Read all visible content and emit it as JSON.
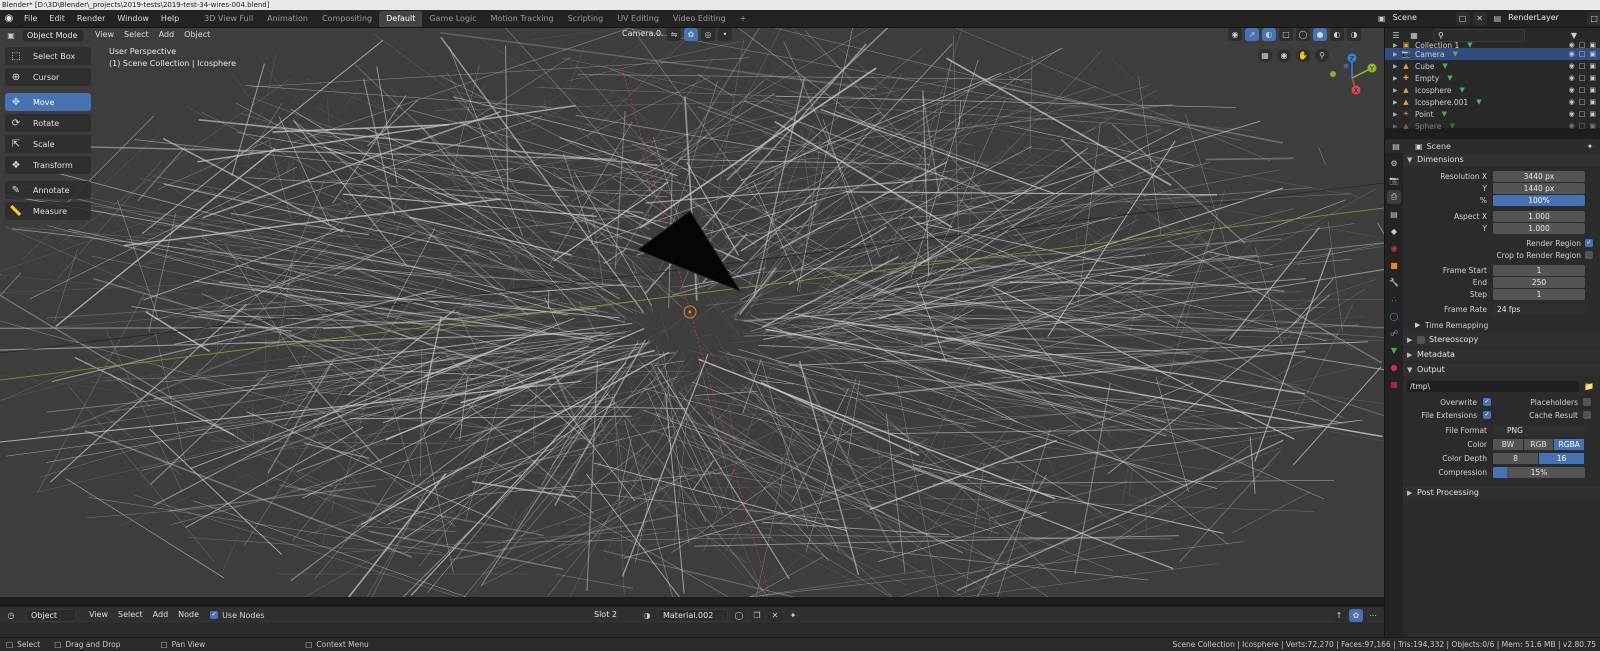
{
  "window": {
    "title": "Blender* [D:\\3D\\Blender\\_projects\\2019-tests\\2019-test-34-wires-004.blend]"
  },
  "menubar": {
    "items": [
      "File",
      "Edit",
      "Render",
      "Window",
      "Help"
    ],
    "workspaces": [
      "3D View Full",
      "Animation",
      "Compositing",
      "Default",
      "Game Logic",
      "Motion Tracking",
      "Scripting",
      "UV Editing",
      "Video Editing"
    ],
    "active_workspace": "Default",
    "add_tab": "+",
    "scene": "Scene",
    "view_layer": "RenderLayer"
  },
  "viewport": {
    "mode": "Object Mode",
    "menus": [
      "View",
      "Select",
      "Add",
      "Object"
    ],
    "camera_field": "Camera.0...",
    "perspective": "User Perspective",
    "collection_info": "(1) Scene Collection | Icosphere",
    "tools": [
      {
        "label": "Select Box",
        "icon": "select-box-icon"
      },
      {
        "label": "Cursor",
        "icon": "cursor-icon"
      },
      {
        "label": "Move",
        "icon": "move-icon",
        "active": true
      },
      {
        "label": "Rotate",
        "icon": "rotate-icon"
      },
      {
        "label": "Scale",
        "icon": "scale-icon"
      },
      {
        "label": "Transform",
        "icon": "transform-icon"
      },
      {
        "label": "Annotate",
        "icon": "annotate-icon"
      },
      {
        "label": "Measure",
        "icon": "measure-icon"
      }
    ],
    "gizmo": {
      "x": "X",
      "y": "Y",
      "z": "Z"
    },
    "colors": {
      "background": "#3d3d3d",
      "wire": "#c8c8c8",
      "x_axis": "#c23b3b",
      "y_axis": "#8a9a2a",
      "active": "#4772b3"
    }
  },
  "shader_header": {
    "editor": "Object",
    "menus": [
      "View",
      "Select",
      "Add",
      "Node"
    ],
    "use_nodes_label": "Use Nodes",
    "slot": "Slot 2",
    "material": "Material.002"
  },
  "statusbar": {
    "select": "Select",
    "drag": "Drag and Drop",
    "pan": "Pan View",
    "context": "Context Menu",
    "stats": "Scene Collection | Icosphere | Verts:72,270 | Faces:97,166 | Tris:194,332 | Objects:0/6 | Mem: 51.6 MB | v2.80.75"
  },
  "outliner": {
    "search_placeholder": "",
    "rows": [
      {
        "name": "Collection 1",
        "icon": "collection-icon",
        "partial": true
      },
      {
        "name": "Camera",
        "icon": "camera-icon",
        "selected": true
      },
      {
        "name": "Cube",
        "icon": "mesh-icon"
      },
      {
        "name": "Empty",
        "icon": "empty-icon"
      },
      {
        "name": "Icosphere",
        "icon": "mesh-icon"
      },
      {
        "name": "Icosphere.001",
        "icon": "mesh-icon"
      },
      {
        "name": "Point",
        "icon": "light-icon"
      },
      {
        "name": "Sphere",
        "icon": "mesh-icon",
        "dim": true
      }
    ]
  },
  "properties": {
    "context": "Scene",
    "dimensions": {
      "title": "Dimensions",
      "res_x_label": "Resolution X",
      "res_x": "3440 px",
      "res_y_label": "Y",
      "res_y": "1440 px",
      "pct_label": "%",
      "pct": "100%",
      "aspect_x_label": "Aspect X",
      "aspect_x": "1.000",
      "aspect_y_label": "Y",
      "aspect_y": "1.000",
      "render_region": "Render Region",
      "crop_region": "Crop to Render Region",
      "frame_start_label": "Frame Start",
      "frame_start": "1",
      "end_label": "End",
      "end": "250",
      "step_label": "Step",
      "step": "1",
      "frame_rate_label": "Frame Rate",
      "frame_rate": "24 fps",
      "time_remapping": "Time Remapping"
    },
    "stereoscopy": "Stereoscopy",
    "metadata": "Metadata",
    "output": {
      "title": "Output",
      "path": "/tmp\\",
      "overwrite": "Overwrite",
      "placeholders": "Placeholders",
      "file_extensions": "File Extensions",
      "cache_result": "Cache Result",
      "file_format_label": "File Format",
      "file_format": "PNG",
      "color_label": "Color",
      "color_options": [
        "BW",
        "RGB",
        "RGBA"
      ],
      "color_selected": "RGBA",
      "depth_label": "Color Depth",
      "depth_options": [
        "8",
        "16"
      ],
      "depth_selected": "16",
      "compression_label": "Compression",
      "compression": "15%"
    },
    "post_processing": "Post Processing"
  }
}
